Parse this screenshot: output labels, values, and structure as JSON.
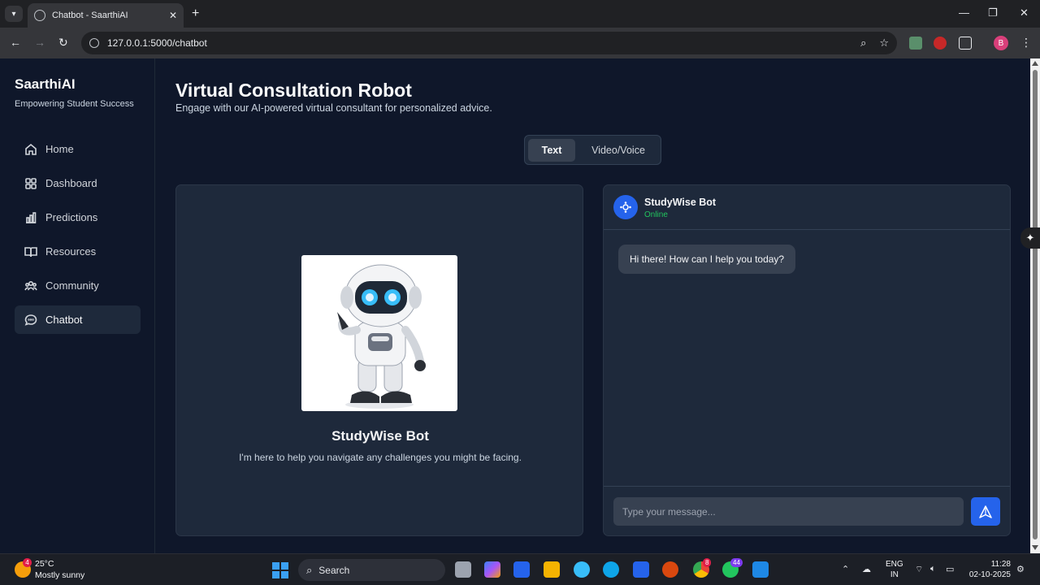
{
  "browser": {
    "tab_title": "Chatbot - SaarthiAI",
    "url": "127.0.0.1:5000/chatbot",
    "profile_initial": "B"
  },
  "sidebar": {
    "brand": "SaarthiAI",
    "tagline": "Empowering Student Success",
    "items": [
      {
        "label": "Home",
        "icon": "home-icon"
      },
      {
        "label": "Dashboard",
        "icon": "dashboard-icon"
      },
      {
        "label": "Predictions",
        "icon": "bar-chart-icon"
      },
      {
        "label": "Resources",
        "icon": "book-icon"
      },
      {
        "label": "Community",
        "icon": "users-icon"
      },
      {
        "label": "Chatbot",
        "icon": "chat-bubble-icon",
        "active": true
      }
    ]
  },
  "header": {
    "title": "Virtual Consultation Robot",
    "subtitle": "Engage with our AI-powered virtual consultant for personalized advice."
  },
  "mode_toggle": {
    "text_label": "Text",
    "video_label": "Video/Voice",
    "selected": "Text"
  },
  "bot_card": {
    "name": "StudyWise Bot",
    "description": "I'm here to help you navigate any challenges you might be facing."
  },
  "chat": {
    "bot_name": "StudyWise Bot",
    "status": "Online",
    "messages": [
      {
        "sender": "bot",
        "text": "Hi there! How can I help you today?"
      }
    ],
    "input_placeholder": "Type your message..."
  },
  "taskbar": {
    "weather_temp": "25°C",
    "weather_cond": "Mostly sunny",
    "weather_badge": "4",
    "search_label": "Search",
    "chrome_badge": "8",
    "whatsapp_badge": "44",
    "language": "ENG",
    "region": "IN",
    "time": "11:28",
    "date": "02-10-2025"
  },
  "colors": {
    "background": "#0f172a",
    "card": "#1e293b",
    "accent": "#2563eb",
    "online": "#22c55e"
  }
}
